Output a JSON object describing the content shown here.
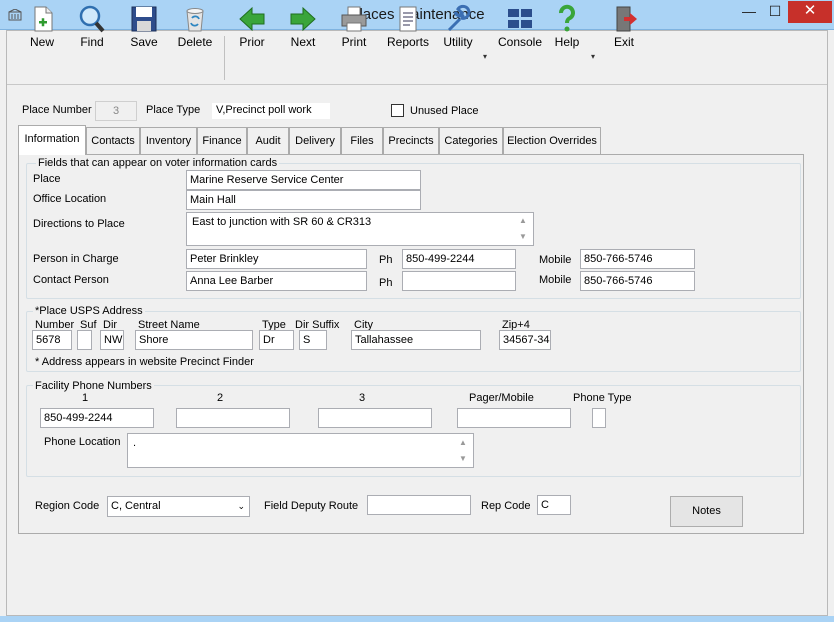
{
  "window": {
    "title": "Places Maintenance",
    "min_glyph": "—",
    "max_glyph": "☐",
    "close_glyph": "✕"
  },
  "toolbar": {
    "new": "New",
    "find": "Find",
    "save": "Save",
    "delete": "Delete",
    "prior": "Prior",
    "next": "Next",
    "print": "Print",
    "reports": "Reports",
    "utility": "Utility",
    "console": "Console",
    "help": "Help",
    "exit": "Exit",
    "dropdown_glyph": "▾"
  },
  "header": {
    "place_number_label": "Place Number",
    "place_number_value": "3",
    "place_type_label": "Place Type",
    "place_type_value": "V,Precinct poll work",
    "unused_place_label": "Unused Place",
    "unused_place_checked": false
  },
  "tabs": [
    "Information",
    "Contacts",
    "Inventory",
    "Finance",
    "Audit",
    "Delivery",
    "Files",
    "Precincts",
    "Categories",
    "Election Overrides"
  ],
  "voter_info": {
    "title": "Fields that can appear on voter information cards",
    "place_label": "Place",
    "place_value": "Marine Reserve Service Center",
    "office_location_label": "Office Location",
    "office_location_value": "Main Hall",
    "directions_label": "Directions to Place",
    "directions_value": "East to junction with SR 60 & CR313",
    "person_in_charge_label": "Person in Charge",
    "person_in_charge_value": "Peter Brinkley",
    "contact_person_label": "Contact Person",
    "contact_person_value": "Anna Lee Barber",
    "ph_label": "Ph",
    "ph1_value": "850-499-2244",
    "ph2_value": "",
    "mobile_label": "Mobile",
    "mobile1_value": "850-766-5746",
    "mobile2_value": "850-766-5746"
  },
  "address": {
    "title": "*Place USPS Address",
    "number_label": "Number",
    "number_value": "5678",
    "suf_label": "Suf",
    "suf_value": "",
    "dir_label": "Dir",
    "dir_value": "NW",
    "street_label": "Street Name",
    "street_value": "Shore",
    "type_label": "Type",
    "type_value": "Dr",
    "dir_suffix_label": "Dir Suffix",
    "dir_suffix_value": "S",
    "city_label": "City",
    "city_value": "Tallahassee",
    "zip_label": "Zip+4",
    "zip_value": "34567-34",
    "note": "* Address appears in website Precinct Finder"
  },
  "facility": {
    "title": "Facility Phone Numbers",
    "col1": "1",
    "col2": "2",
    "col3": "3",
    "pager_label": "Pager/Mobile",
    "phone_type_label": "Phone Type",
    "phone1_value": "850-499-2244",
    "phone2_value": "",
    "phone3_value": "",
    "pager_value": "",
    "phone_type_value": "",
    "phone_location_label": "Phone Location",
    "phone_location_value": "."
  },
  "bottom": {
    "region_code_label": "Region Code",
    "region_code_value": "C, Central",
    "field_deputy_label": "Field Deputy Route",
    "field_deputy_value": "",
    "rep_code_label": "Rep Code",
    "rep_code_value": "C",
    "notes_button": "Notes"
  },
  "colors": {
    "titlebar": "#aad3f5",
    "close": "#c7302a"
  }
}
